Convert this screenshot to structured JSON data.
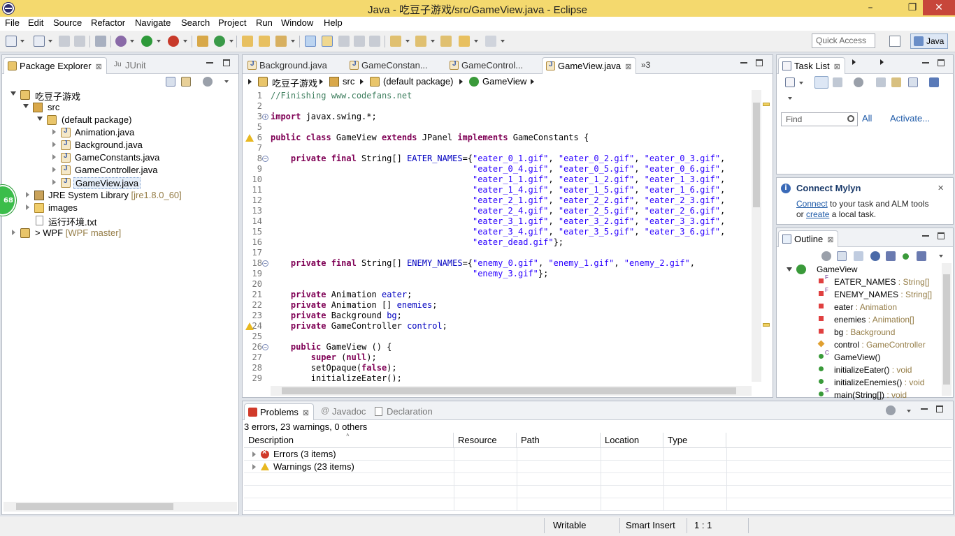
{
  "window": {
    "title": "Java - 吃豆子游戏/src/GameView.java - Eclipse",
    "minimize": "–",
    "restore": "❐",
    "close": "✕"
  },
  "menu": [
    "File",
    "Edit",
    "Source",
    "Refactor",
    "Navigate",
    "Search",
    "Project",
    "Run",
    "Window",
    "Help"
  ],
  "toolbar": {
    "quick_access_placeholder": "Quick Access",
    "perspective": "Java"
  },
  "explorer": {
    "tabs": [
      {
        "label": "Package Explorer",
        "close": "⊠"
      },
      {
        "label": "JUnit"
      }
    ],
    "badge": "68",
    "tree": [
      {
        "label": "吃豆子游戏",
        "icon": "project-icon"
      },
      {
        "label": "src",
        "icon": "source-folder-icon"
      },
      {
        "label": "(default package)",
        "icon": "package-icon"
      },
      {
        "label": "Animation.java",
        "icon": "java-file-icon"
      },
      {
        "label": "Background.java",
        "icon": "java-file-icon"
      },
      {
        "label": "GameConstants.java",
        "icon": "java-file-icon"
      },
      {
        "label": "GameController.java",
        "icon": "java-file-icon"
      },
      {
        "label": "GameView.java",
        "icon": "java-file-icon"
      },
      {
        "label": "JRE System Library",
        "deco": "[jre1.8.0_60]",
        "icon": "library-icon"
      },
      {
        "label": "images",
        "icon": "folder-icon"
      },
      {
        "label": "运行环境.txt",
        "icon": "text-file-icon"
      },
      {
        "prefix": ">",
        "label": "WPF",
        "deco": "[WPF master]",
        "icon": "project-icon"
      }
    ]
  },
  "editor": {
    "tabs": [
      {
        "label": "Background.java"
      },
      {
        "label": "GameConstan..."
      },
      {
        "label": "GameControl..."
      },
      {
        "label": "GameView.java",
        "close": "⊠"
      }
    ],
    "overflow": "»3",
    "breadcrumb": [
      "吃豆子游戏",
      "src",
      "(default package)",
      "GameView"
    ],
    "lines": [
      {
        "n": "1",
        "html": "<span class=\"cm\">//Finishing www.codefans.net</span>"
      },
      {
        "n": "2",
        "html": ""
      },
      {
        "n": "3",
        "html": "<span class=\"kw\">import</span> javax.swing.*;",
        "fold": "+"
      },
      {
        "n": "5",
        "html": ""
      },
      {
        "n": "6",
        "html": "<span class=\"kw\">public class</span> GameView <span class=\"kw\">extends</span> JPanel <span class=\"kw\">implements</span> GameConstants {",
        "warn": true
      },
      {
        "n": "7",
        "html": ""
      },
      {
        "n": "8",
        "html": "    <span class=\"kw\">private final</span> String[] <span class=\"fld\">EATER_NAMES</span>={<span class=\"str\">\"eater_0_1.gif\"</span>, <span class=\"str\">\"eater_0_2.gif\"</span>, <span class=\"str\">\"eater_0_3.gif\"</span>,",
        "fold": "−"
      },
      {
        "n": "9",
        "html": "                                        <span class=\"str\">\"eater_0_4.gif\"</span>, <span class=\"str\">\"eater_0_5.gif\"</span>, <span class=\"str\">\"eater_0_6.gif\"</span>,"
      },
      {
        "n": "10",
        "html": "                                        <span class=\"str\">\"eater_1_1.gif\"</span>, <span class=\"str\">\"eater_1_2.gif\"</span>, <span class=\"str\">\"eater_1_3.gif\"</span>,"
      },
      {
        "n": "11",
        "html": "                                        <span class=\"str\">\"eater_1_4.gif\"</span>, <span class=\"str\">\"eater_1_5.gif\"</span>, <span class=\"str\">\"eater_1_6.gif\"</span>,"
      },
      {
        "n": "12",
        "html": "                                        <span class=\"str\">\"eater_2_1.gif\"</span>, <span class=\"str\">\"eater_2_2.gif\"</span>, <span class=\"str\">\"eater_2_3.gif\"</span>,"
      },
      {
        "n": "13",
        "html": "                                        <span class=\"str\">\"eater_2_4.gif\"</span>, <span class=\"str\">\"eater_2_5.gif\"</span>, <span class=\"str\">\"eater_2_6.gif\"</span>,"
      },
      {
        "n": "14",
        "html": "                                        <span class=\"str\">\"eater_3_1.gif\"</span>, <span class=\"str\">\"eater_3_2.gif\"</span>, <span class=\"str\">\"eater_3_3.gif\"</span>,"
      },
      {
        "n": "15",
        "html": "                                        <span class=\"str\">\"eater_3_4.gif\"</span>, <span class=\"str\">\"eater_3_5.gif\"</span>, <span class=\"str\">\"eater_3_6.gif\"</span>,"
      },
      {
        "n": "16",
        "html": "                                        <span class=\"str\">\"eater_dead.gif\"</span>};"
      },
      {
        "n": "17",
        "html": ""
      },
      {
        "n": "18",
        "html": "    <span class=\"kw\">private final</span> String[] <span class=\"fld\">ENEMY_NAMES</span>={<span class=\"str\">\"enemy_0.gif\"</span>, <span class=\"str\">\"enemy_1.gif\"</span>, <span class=\"str\">\"enemy_2.gif\"</span>,",
        "fold": "−"
      },
      {
        "n": "19",
        "html": "                                        <span class=\"str\">\"enemy_3.gif\"</span>};"
      },
      {
        "n": "20",
        "html": ""
      },
      {
        "n": "21",
        "html": "    <span class=\"kw\">private</span> Animation <span class=\"fld\">eater</span>;"
      },
      {
        "n": "22",
        "html": "    <span class=\"kw\">private</span> Animation [] <span class=\"fld\">enemies</span>;"
      },
      {
        "n": "23",
        "html": "    <span class=\"kw\">private</span> Background <span class=\"fld\">bg</span>;"
      },
      {
        "n": "24",
        "html": "    <span class=\"kw\">private</span> GameController <span class=\"fld\">control</span>;",
        "warn": true
      },
      {
        "n": "25",
        "html": ""
      },
      {
        "n": "26",
        "html": "    <span class=\"kw\">public</span> GameView () {",
        "fold": "−"
      },
      {
        "n": "27",
        "html": "        <span class=\"kw\">super</span> (<span class=\"kw\">null</span>);"
      },
      {
        "n": "28",
        "html": "        setOpaque(<span class=\"kw\">false</span>);"
      },
      {
        "n": "29",
        "html": "        initializeEater();"
      }
    ]
  },
  "tasklist": {
    "tab": "Task List",
    "close": "⊠",
    "find_placeholder": "Find",
    "all": "All",
    "activate": "Activate..."
  },
  "mylyn": {
    "title": "Connect Mylyn",
    "close": "✕",
    "connect": "Connect",
    "text1": " to your task and ALM tools",
    "or": "or ",
    "create": "create",
    "text2": " a local task."
  },
  "outline": {
    "tab": "Outline",
    "close": "⊠",
    "root": "GameView",
    "items": [
      {
        "name": "EATER_NAMES",
        "type": " : String[]",
        "kind": "priv",
        "sup": "F"
      },
      {
        "name": "ENEMY_NAMES",
        "type": " : String[]",
        "kind": "priv",
        "sup": "F"
      },
      {
        "name": "eater",
        "type": " : Animation",
        "kind": "priv"
      },
      {
        "name": "enemies",
        "type": " : Animation[]",
        "kind": "priv"
      },
      {
        "name": "bg",
        "type": " : Background",
        "kind": "priv"
      },
      {
        "name": "control",
        "type": " : GameController",
        "kind": "prot"
      },
      {
        "name": "GameView()",
        "type": "",
        "kind": "meth",
        "sup": "C"
      },
      {
        "name": "initializeEater()",
        "type": " : void",
        "kind": "meth"
      },
      {
        "name": "initializeEnemies()",
        "type": " : void",
        "kind": "meth"
      },
      {
        "name": "main(String[])",
        "type": " : void",
        "kind": "meth",
        "sup": "S"
      }
    ]
  },
  "problems": {
    "tabs": [
      {
        "label": "Problems",
        "close": "⊠"
      },
      {
        "label": "Javadoc"
      },
      {
        "label": "Declaration"
      }
    ],
    "summary": "3 errors, 23 warnings, 0 others",
    "columns": [
      "Description",
      "Resource",
      "Path",
      "Location",
      "Type"
    ],
    "rows": [
      {
        "label": "Errors (3 items)",
        "kind": "error"
      },
      {
        "label": "Warnings (23 items)",
        "kind": "warning"
      }
    ]
  },
  "status": {
    "writable": "Writable",
    "insert_mode": "Smart Insert",
    "position": "1 : 1"
  }
}
